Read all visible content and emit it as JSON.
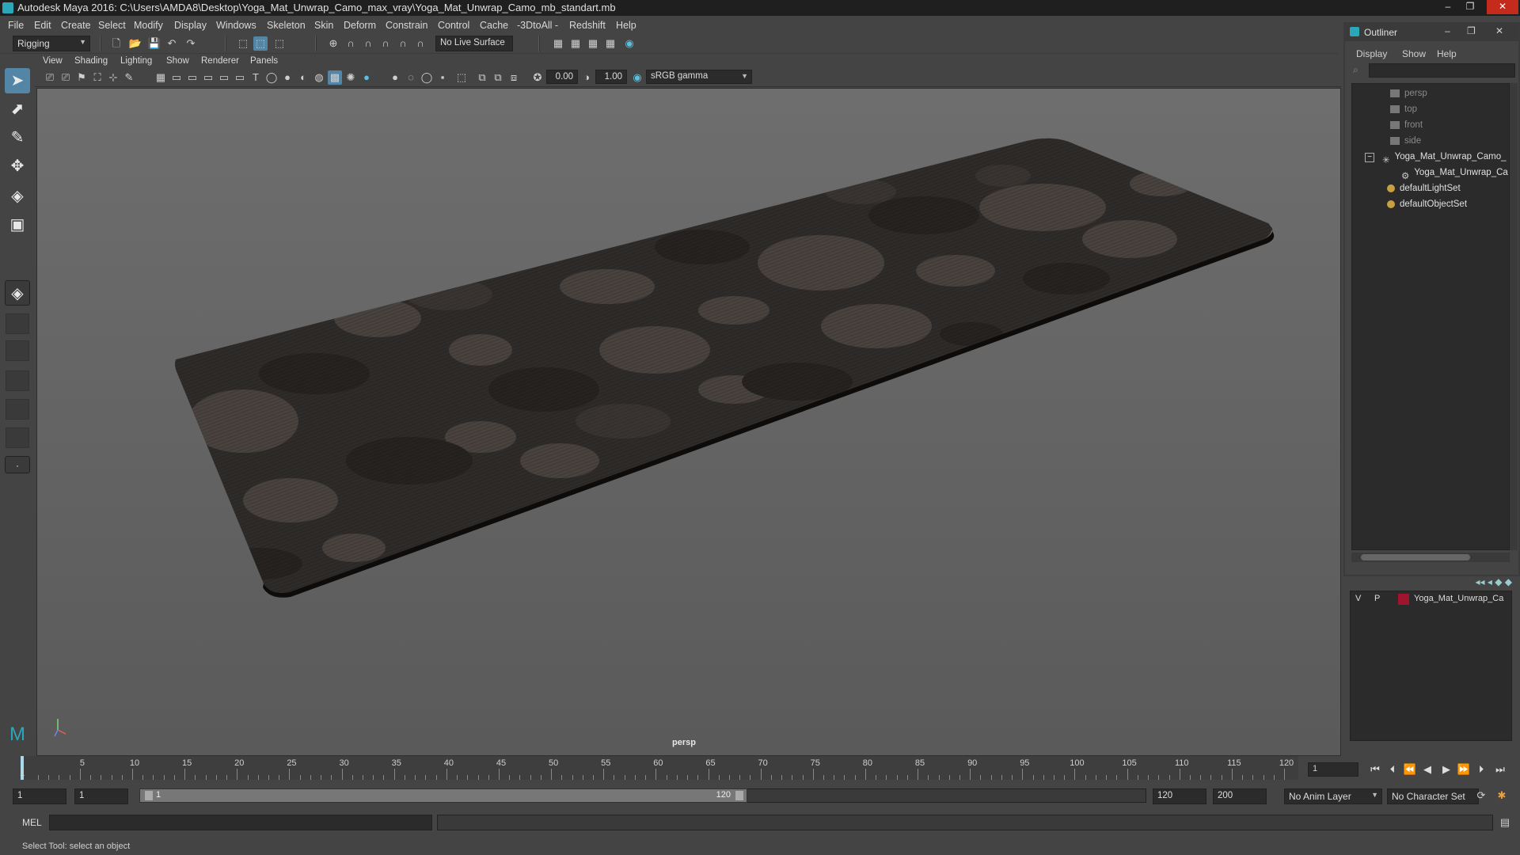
{
  "window": {
    "title": "Autodesk Maya 2016: C:\\Users\\AMDA8\\Desktop\\Yoga_Mat_Unwrap_Camo_max_vray\\Yoga_Mat_Unwrap_Camo_mb_standart.mb",
    "minimize": "–",
    "restore": "❐",
    "close": "✕"
  },
  "menubar": {
    "items": [
      "File",
      "Edit",
      "Create",
      "Select",
      "Modify",
      "Display",
      "Windows",
      "Skeleton",
      "Skin",
      "Deform",
      "Constrain",
      "Control",
      "Cache",
      "-3DtoAll -",
      "Redshift",
      "Help"
    ]
  },
  "shelf": {
    "mode": "Rigging",
    "live_surface": "No Live Surface"
  },
  "viewport": {
    "menu": [
      "View",
      "Shading",
      "Lighting",
      "Show",
      "Renderer",
      "Panels"
    ],
    "exposure": "0.00",
    "gamma": "1.00",
    "color_space": "sRGB gamma",
    "camera_label": "persp",
    "colors": {
      "mat_base": "#2f2c2a",
      "camo_dark": "#262321",
      "camo_light": "#4a4340",
      "camo_mid": "#3a3532"
    }
  },
  "outliner": {
    "title": "Outliner",
    "menu": [
      "Display",
      "Show",
      "Help"
    ],
    "items": [
      {
        "label": "persp",
        "icon": "camera-icon",
        "style": "dim"
      },
      {
        "label": "top",
        "icon": "camera-icon",
        "style": "dim"
      },
      {
        "label": "front",
        "icon": "camera-icon",
        "style": "dim"
      },
      {
        "label": "side",
        "icon": "camera-icon",
        "style": "dim"
      },
      {
        "label": "Yoga_Mat_Unwrap_Camo_",
        "icon": "group-icon",
        "style": "bright"
      },
      {
        "label": "Yoga_Mat_Unwrap_Ca",
        "icon": "mesh-icon",
        "style": "bright"
      },
      {
        "label": "defaultLightSet",
        "icon": "set-icon",
        "style": "bright"
      },
      {
        "label": "defaultObjectSet",
        "icon": "set-icon",
        "style": "bright"
      }
    ]
  },
  "layers": {
    "row": {
      "v": "V",
      "p": "P",
      "name": "Yoga_Mat_Unwrap_Ca",
      "color": "#a0142e"
    }
  },
  "timeline": {
    "ticks": [
      "5",
      "10",
      "15",
      "20",
      "25",
      "30",
      "35",
      "40",
      "45",
      "50",
      "55",
      "60",
      "65",
      "70",
      "75",
      "80",
      "85",
      "90",
      "95",
      "100",
      "105",
      "110",
      "115",
      "120"
    ],
    "start_tick": "1",
    "current_frame": "1"
  },
  "range": {
    "start": "1",
    "anim_start": "1",
    "slider_start": "1",
    "slider_end": "120",
    "end": "120",
    "anim_end": "200",
    "anim_layer": "No Anim Layer",
    "character_set": "No Character Set"
  },
  "command": {
    "mel_label": "MEL",
    "help_text": "Select Tool: select an object"
  }
}
